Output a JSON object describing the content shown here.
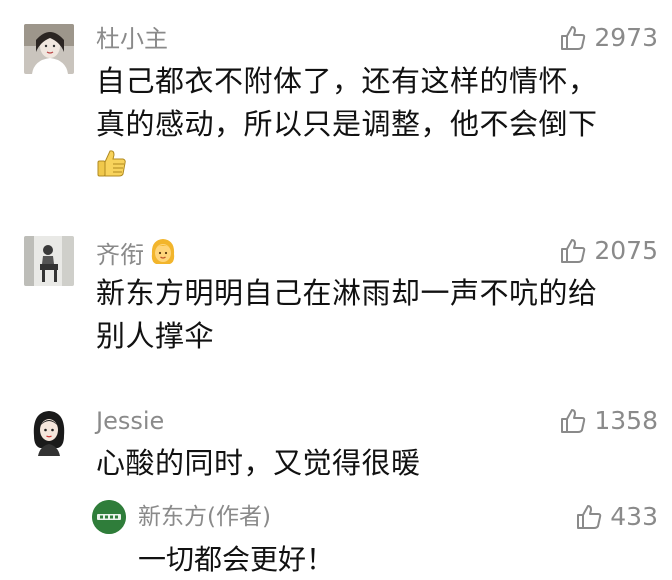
{
  "comments": [
    {
      "username": "杜小主",
      "likes": "2973",
      "line1": "自己都衣不附体了，还有这样的情怀，",
      "line2": "真的感动，所以只是调整，他不会倒下",
      "emoji": "thumbs-up-emoji-icon"
    },
    {
      "username": "齐衔",
      "likes": "2075",
      "line1": "新东方明明自己在淋雨却一声不吭的给",
      "line2": "别人撑伞",
      "name_emoji": "blonde-woman-emoji-icon"
    },
    {
      "username": "Jessie",
      "likes": "1358",
      "line1": "心酸的同时，又觉得很暖"
    }
  ],
  "reply": {
    "username": "新东方(作者)",
    "likes": "433",
    "text": "一切都会更好！"
  },
  "colors": {
    "meta": "#8a8a8a",
    "text": "#111111",
    "brand_green": "#2f7d3a"
  }
}
